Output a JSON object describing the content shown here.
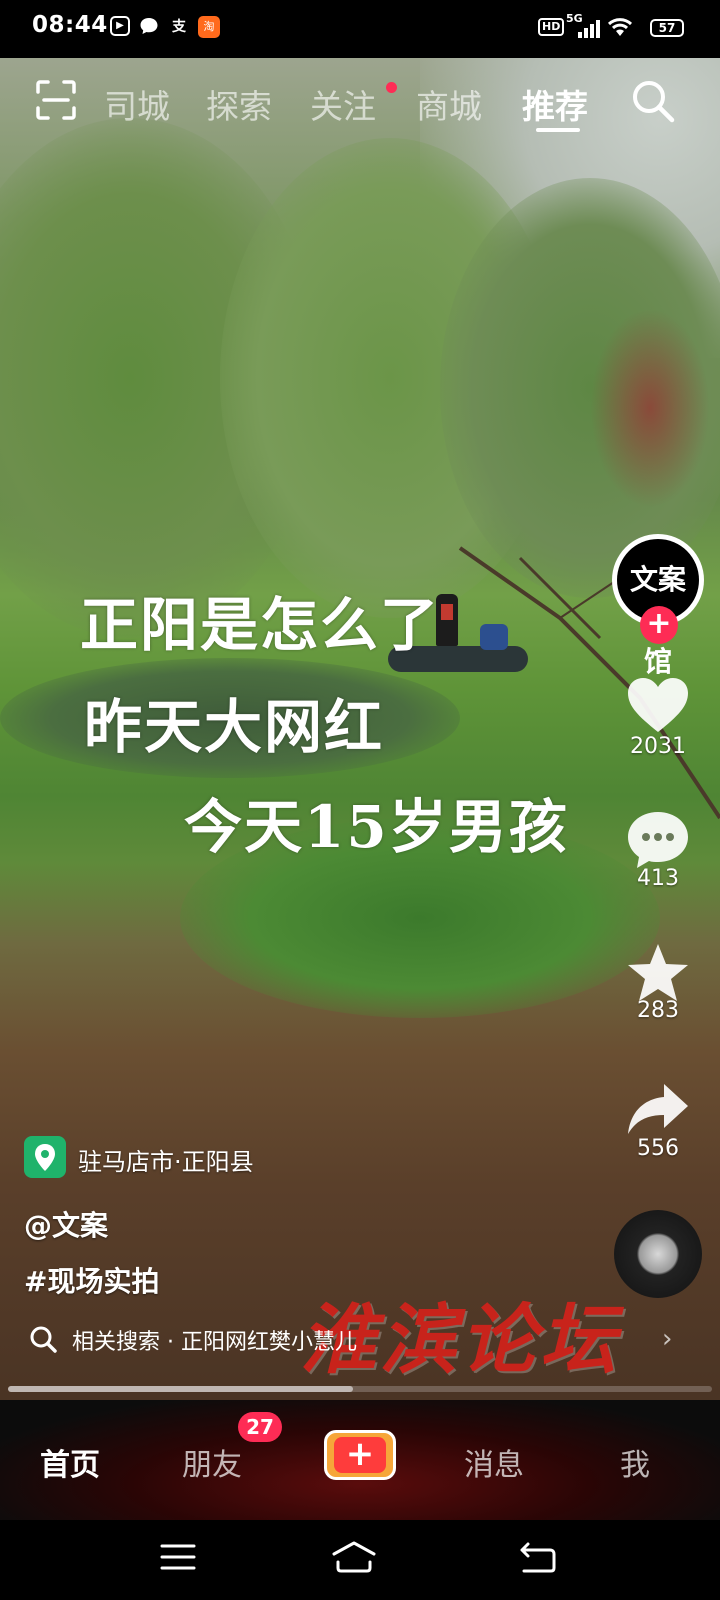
{
  "status_bar": {
    "time": "08:44",
    "app_icons": [
      "play-icon",
      "chat-bubble-icon",
      "alipay-icon",
      "taobao-icon"
    ],
    "hd_label": "HD",
    "network_label": "5G",
    "battery": "57"
  },
  "top_nav": {
    "tabs": [
      "司城",
      "探索",
      "关注",
      "商城",
      "推荐"
    ],
    "active_tab": "推荐"
  },
  "video": {
    "caption_lines": [
      "正阳是怎么了",
      "昨天大网红",
      "今天15岁男孩"
    ]
  },
  "creator": {
    "avatar_text": "文案馆"
  },
  "actions": {
    "likes": "2031",
    "comments": "413",
    "favorites": "283",
    "shares": "556"
  },
  "info": {
    "location": "驻马店市·正阳县",
    "author": "@文案",
    "hashtag": "#现场实拍",
    "related_search": "相关搜索 · 正阳网红樊小慧儿",
    "watermark": "淮滨论坛",
    "progress": 0.49
  },
  "bottom_nav": {
    "home": "首页",
    "friends": "朋友",
    "friends_badge": "27",
    "messages": "消息",
    "me": "我",
    "create_symbol": "+"
  },
  "colors": {
    "accent": "#fe2c55",
    "location_green": "#1fb36b",
    "watermark_red": "#c8231b"
  }
}
